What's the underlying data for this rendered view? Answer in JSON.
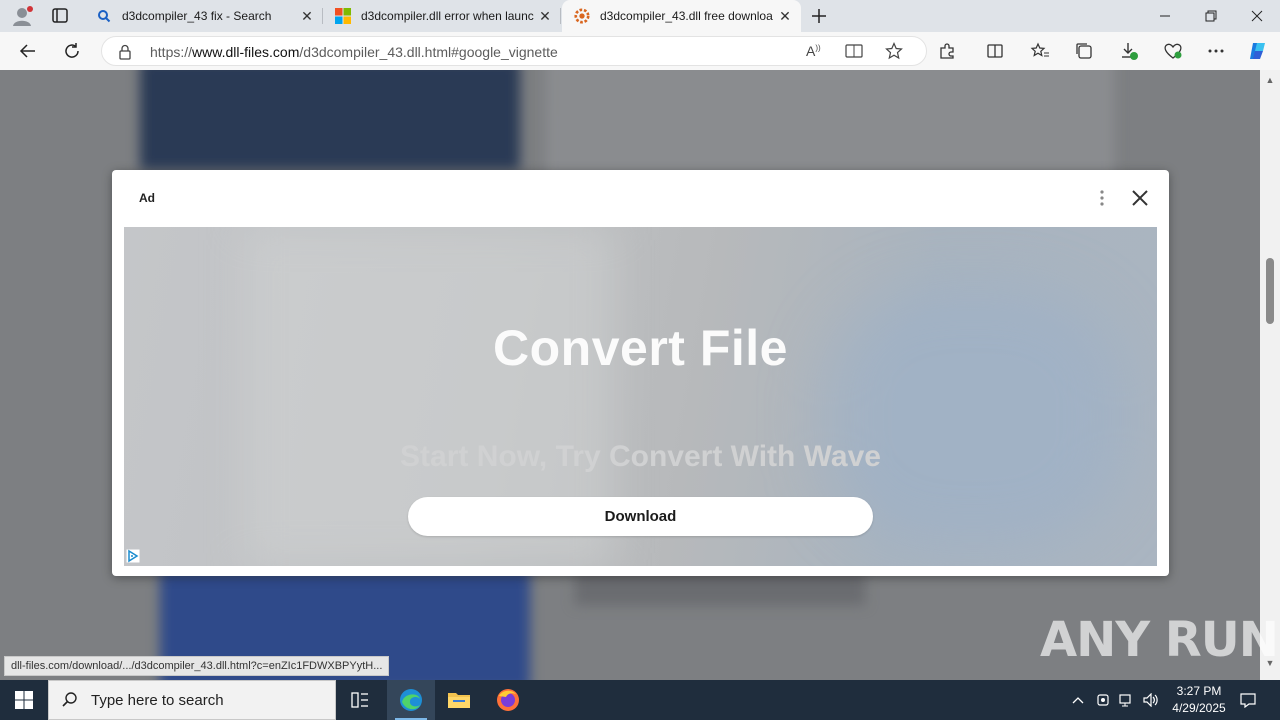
{
  "browser": {
    "tabs": [
      {
        "title": "d3dcompiler_43 fix - Search",
        "icon": "search-icon",
        "active": false
      },
      {
        "title": "d3dcompiler.dll error when launc",
        "icon": "microsoft-logo-icon",
        "active": false
      },
      {
        "title": "d3dcompiler_43.dll free downloa",
        "icon": "dll-files-logo-icon",
        "active": true
      }
    ],
    "new_tab_icon": "plus-icon",
    "url_prefix": "https://",
    "url_host": "www.dll-files.com",
    "url_path": "/d3dcompiler_43.dll.html#google_vignette"
  },
  "ad": {
    "label": "Ad",
    "headline": "Convert File",
    "subline": "Start Now, Try Convert With Wave",
    "download_label": "Download"
  },
  "status_url": "dll-files.com/download/.../d3dcompiler_43.dll.html?c=enZIc1FDWXBPYytH...",
  "watermark": "ANY RUN",
  "taskbar": {
    "search_placeholder": "Type here to search",
    "time": "3:27 PM",
    "date": "4/29/2025"
  },
  "colors": {
    "tabstrip": "#dfe3e8",
    "toolbar": "#f7f7f7",
    "page_dim": "#7d7f82",
    "taskbar": "#1f2d3d",
    "copilot_accent": "#1a7be0"
  }
}
